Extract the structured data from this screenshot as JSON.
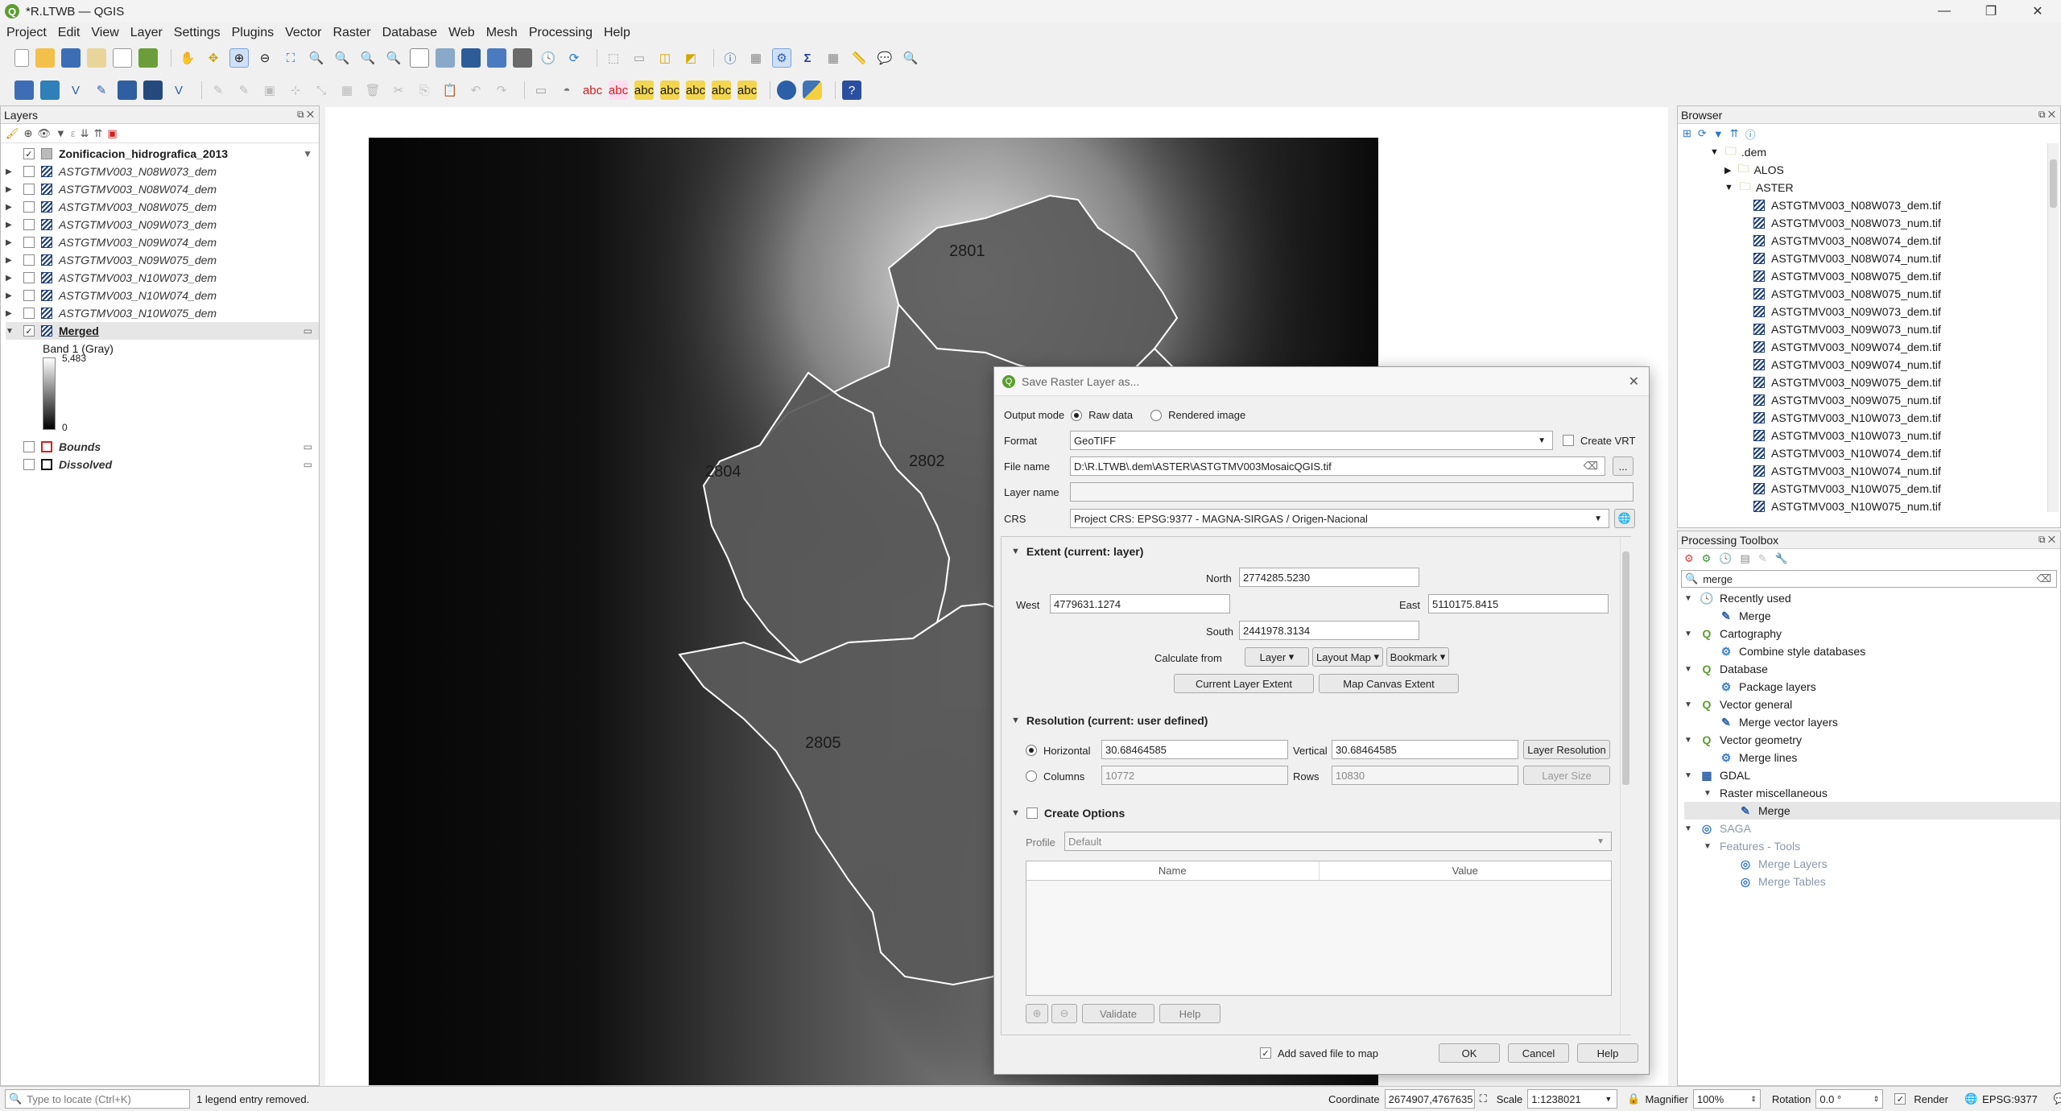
{
  "window": {
    "title": "*R.LTWB — QGIS",
    "controls": [
      "—",
      "❐",
      "✕"
    ]
  },
  "menu": [
    "Project",
    "Edit",
    "View",
    "Layer",
    "Settings",
    "Plugins",
    "Vector",
    "Raster",
    "Database",
    "Web",
    "Mesh",
    "Processing",
    "Help"
  ],
  "layers_panel": {
    "title": "Layers",
    "items": [
      {
        "name": "Zonificacion_hidrografica_2013",
        "checked": true,
        "bold": true,
        "italic": false
      },
      {
        "name": "ASTGTMV003_N08W073_dem",
        "checked": false,
        "italic": true
      },
      {
        "name": "ASTGTMV003_N08W074_dem",
        "checked": false,
        "italic": true
      },
      {
        "name": "ASTGTMV003_N08W075_dem",
        "checked": false,
        "italic": true
      },
      {
        "name": "ASTGTMV003_N09W073_dem",
        "checked": false,
        "italic": true
      },
      {
        "name": "ASTGTMV003_N09W074_dem",
        "checked": false,
        "italic": true
      },
      {
        "name": "ASTGTMV003_N09W075_dem",
        "checked": false,
        "italic": true
      },
      {
        "name": "ASTGTMV003_N10W073_dem",
        "checked": false,
        "italic": true
      },
      {
        "name": "ASTGTMV003_N10W074_dem",
        "checked": false,
        "italic": true
      },
      {
        "name": "ASTGTMV003_N10W075_dem",
        "checked": false,
        "italic": true
      },
      {
        "name": "Merged",
        "checked": true,
        "bold": true,
        "underline": true
      }
    ],
    "band_label": "Band 1 (Gray)",
    "ramp_max": "5,483",
    "ramp_min": "0",
    "extra": [
      {
        "name": "Bounds",
        "checked": false,
        "color": "#d62020"
      },
      {
        "name": "Dissolved",
        "checked": false,
        "color": "#111111"
      }
    ]
  },
  "map": {
    "labels": [
      "2801",
      "2802",
      "2804",
      "2805"
    ]
  },
  "browser": {
    "title": "Browser",
    "root": ".dem",
    "folders": [
      "ALOS",
      "ASTER"
    ],
    "files": [
      "ASTGTMV003_N08W073_dem.tif",
      "ASTGTMV003_N08W073_num.tif",
      "ASTGTMV003_N08W074_dem.tif",
      "ASTGTMV003_N08W074_num.tif",
      "ASTGTMV003_N08W075_dem.tif",
      "ASTGTMV003_N08W075_num.tif",
      "ASTGTMV003_N09W073_dem.tif",
      "ASTGTMV003_N09W073_num.tif",
      "ASTGTMV003_N09W074_dem.tif",
      "ASTGTMV003_N09W074_num.tif",
      "ASTGTMV003_N09W075_dem.tif",
      "ASTGTMV003_N09W075_num.tif",
      "ASTGTMV003_N10W073_dem.tif",
      "ASTGTMV003_N10W073_num.tif",
      "ASTGTMV003_N10W074_dem.tif",
      "ASTGTMV003_N10W074_num.tif",
      "ASTGTMV003_N10W075_dem.tif",
      "ASTGTMV003_N10W075_num.tif"
    ]
  },
  "toolbox": {
    "title": "Processing Toolbox",
    "search": "merge",
    "tree": [
      {
        "level": 0,
        "label": "Recently used",
        "icon": "clock"
      },
      {
        "level": 1,
        "label": "Merge",
        "icon": "tool"
      },
      {
        "level": 0,
        "label": "Cartography",
        "icon": "qgis"
      },
      {
        "level": 1,
        "label": "Combine style databases",
        "icon": "gear"
      },
      {
        "level": 0,
        "label": "Database",
        "icon": "qgis"
      },
      {
        "level": 1,
        "label": "Package layers",
        "icon": "gear"
      },
      {
        "level": 0,
        "label": "Vector general",
        "icon": "qgis"
      },
      {
        "level": 1,
        "label": "Merge vector layers",
        "icon": "tool"
      },
      {
        "level": 0,
        "label": "Vector geometry",
        "icon": "qgis"
      },
      {
        "level": 1,
        "label": "Merge lines",
        "icon": "gear"
      },
      {
        "level": 0,
        "label": "GDAL",
        "icon": "gdal"
      },
      {
        "level": 1,
        "label": "Raster miscellaneous",
        "icon": "none"
      },
      {
        "level": 2,
        "label": "Merge",
        "icon": "tool",
        "selected": true
      },
      {
        "level": 0,
        "label": "SAGA",
        "icon": "saga",
        "dim": true
      },
      {
        "level": 1,
        "label": "Features - Tools",
        "icon": "none",
        "dim": true
      },
      {
        "level": 2,
        "label": "Merge Layers",
        "icon": "saga",
        "dim": true
      },
      {
        "level": 2,
        "label": "Merge Tables",
        "icon": "saga",
        "dim": true
      }
    ]
  },
  "dialog": {
    "title": "Save Raster Layer as...",
    "output_mode_label": "Output mode",
    "raw_data": "Raw data",
    "rendered_image": "Rendered image",
    "format_label": "Format",
    "format_value": "GeoTIFF",
    "create_vrt": "Create VRT",
    "file_name_label": "File name",
    "file_name_value": "D:\\R.LTWB\\.dem\\ASTER\\ASTGTMV003MosaicQGIS.tif",
    "browse": "...",
    "layer_name_label": "Layer name",
    "crs_label": "CRS",
    "crs_value": "Project CRS: EPSG:9377 - MAGNA-SIRGAS / Origen-Nacional",
    "extent_title": "Extent (current: layer)",
    "north_label": "North",
    "north": "2774285.5230",
    "west_label": "West",
    "west": "4779631.1274",
    "east_label": "East",
    "east": "5110175.8415",
    "south_label": "South",
    "south": "2441978.3134",
    "calculate_from": "Calculate from",
    "calc_layer": "Layer",
    "calc_layout": "Layout Map",
    "calc_bookmark": "Bookmark",
    "current_layer_extent": "Current Layer Extent",
    "map_canvas_extent": "Map Canvas Extent",
    "resolution_title": "Resolution (current: user defined)",
    "horizontal_label": "Horizontal",
    "horizontal": "30.68464585",
    "vertical_label": "Vertical",
    "vertical": "30.68464585",
    "layer_resolution": "Layer Resolution",
    "columns_label": "Columns",
    "columns": "10772",
    "rows_label": "Rows",
    "rows": "10830",
    "layer_size": "Layer Size",
    "create_options": "Create Options",
    "profile_label": "Profile",
    "profile_value": "Default",
    "col_name": "Name",
    "col_value": "Value",
    "validate": "Validate",
    "help_inner": "Help",
    "add_to_map": "Add saved file to map",
    "ok": "OK",
    "cancel": "Cancel",
    "help": "Help"
  },
  "status": {
    "locate_placeholder": "Type to locate (Ctrl+K)",
    "message": "1 legend entry removed.",
    "coordinate_label": "Coordinate",
    "coordinate": "2674907,4767635",
    "scale_label": "Scale",
    "scale": "1:1238021",
    "magnifier_label": "Magnifier",
    "magnifier": "100%",
    "rotation_label": "Rotation",
    "rotation": "0.0 °",
    "render": "Render",
    "crs": "EPSG:9377"
  }
}
